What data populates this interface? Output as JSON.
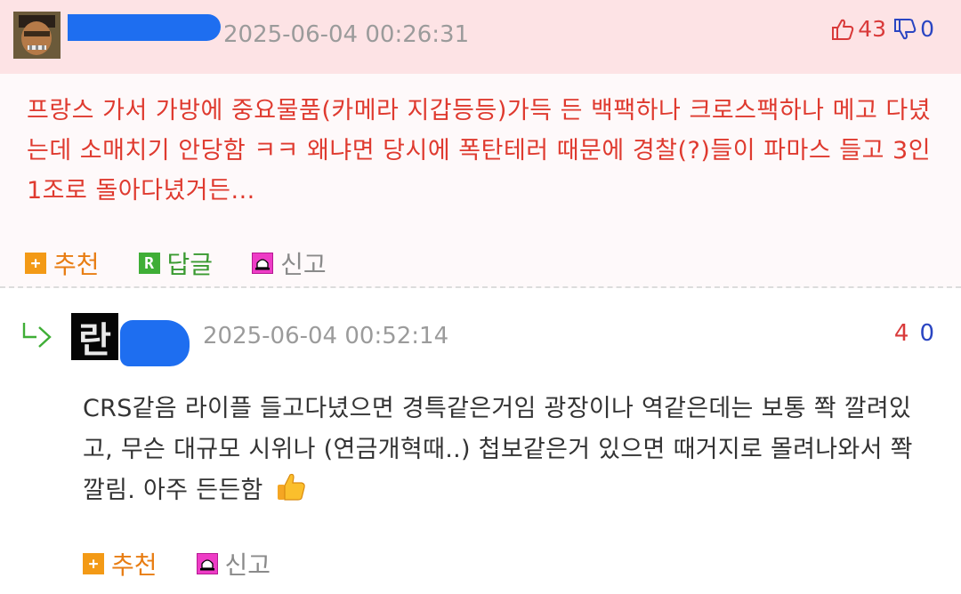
{
  "comments": [
    {
      "timestamp": "2025-06-04 00:26:31",
      "upvotes": "43",
      "downvotes": "0",
      "body": "프랑스 가서 가방에 중요물품(카메라 지갑등등)가득 든 백팩하나 크로스팩하나 메고 다녔는데 소매치기 안당함 ㅋㅋ 왜냐면 당시에 폭탄테러 때문에 경찰(?)들이 파마스 들고 3인 1조로 돌아다녔거든...",
      "actions": {
        "recommend": "추천",
        "reply": "답글",
        "report": "신고"
      }
    },
    {
      "avatar_text": "란",
      "timestamp": "2025-06-04 00:52:14",
      "upvotes": "4",
      "downvotes": "0",
      "body": "CRS같음 라이플 들고다녔으면 경특같은거임 광장이나 역같은데는 보통 쫙 깔려있고, 무슨 대규모 시위나 (연금개혁때..) 첩보같은거 있으면 때거지로 몰려나와서 쫙 깔림. 아주 든든함",
      "actions": {
        "recommend": "추천",
        "report": "신고"
      }
    }
  ],
  "icons": {
    "recommend": "plus-icon",
    "reply": "r-icon",
    "report": "siren-icon",
    "upvote": "thumbs-up-icon",
    "downvote": "thumbs-down-icon",
    "reply_indicator": "reply-arrow-icon",
    "emoji": "thumbs-up-emoji"
  },
  "colors": {
    "header_bg": "#fde3e5",
    "best_comment_text": "#df3a2f",
    "upvote": "#d93a3a",
    "downvote": "#2a45c2",
    "recommend": "#e87d13",
    "reply": "#3a9a31"
  }
}
